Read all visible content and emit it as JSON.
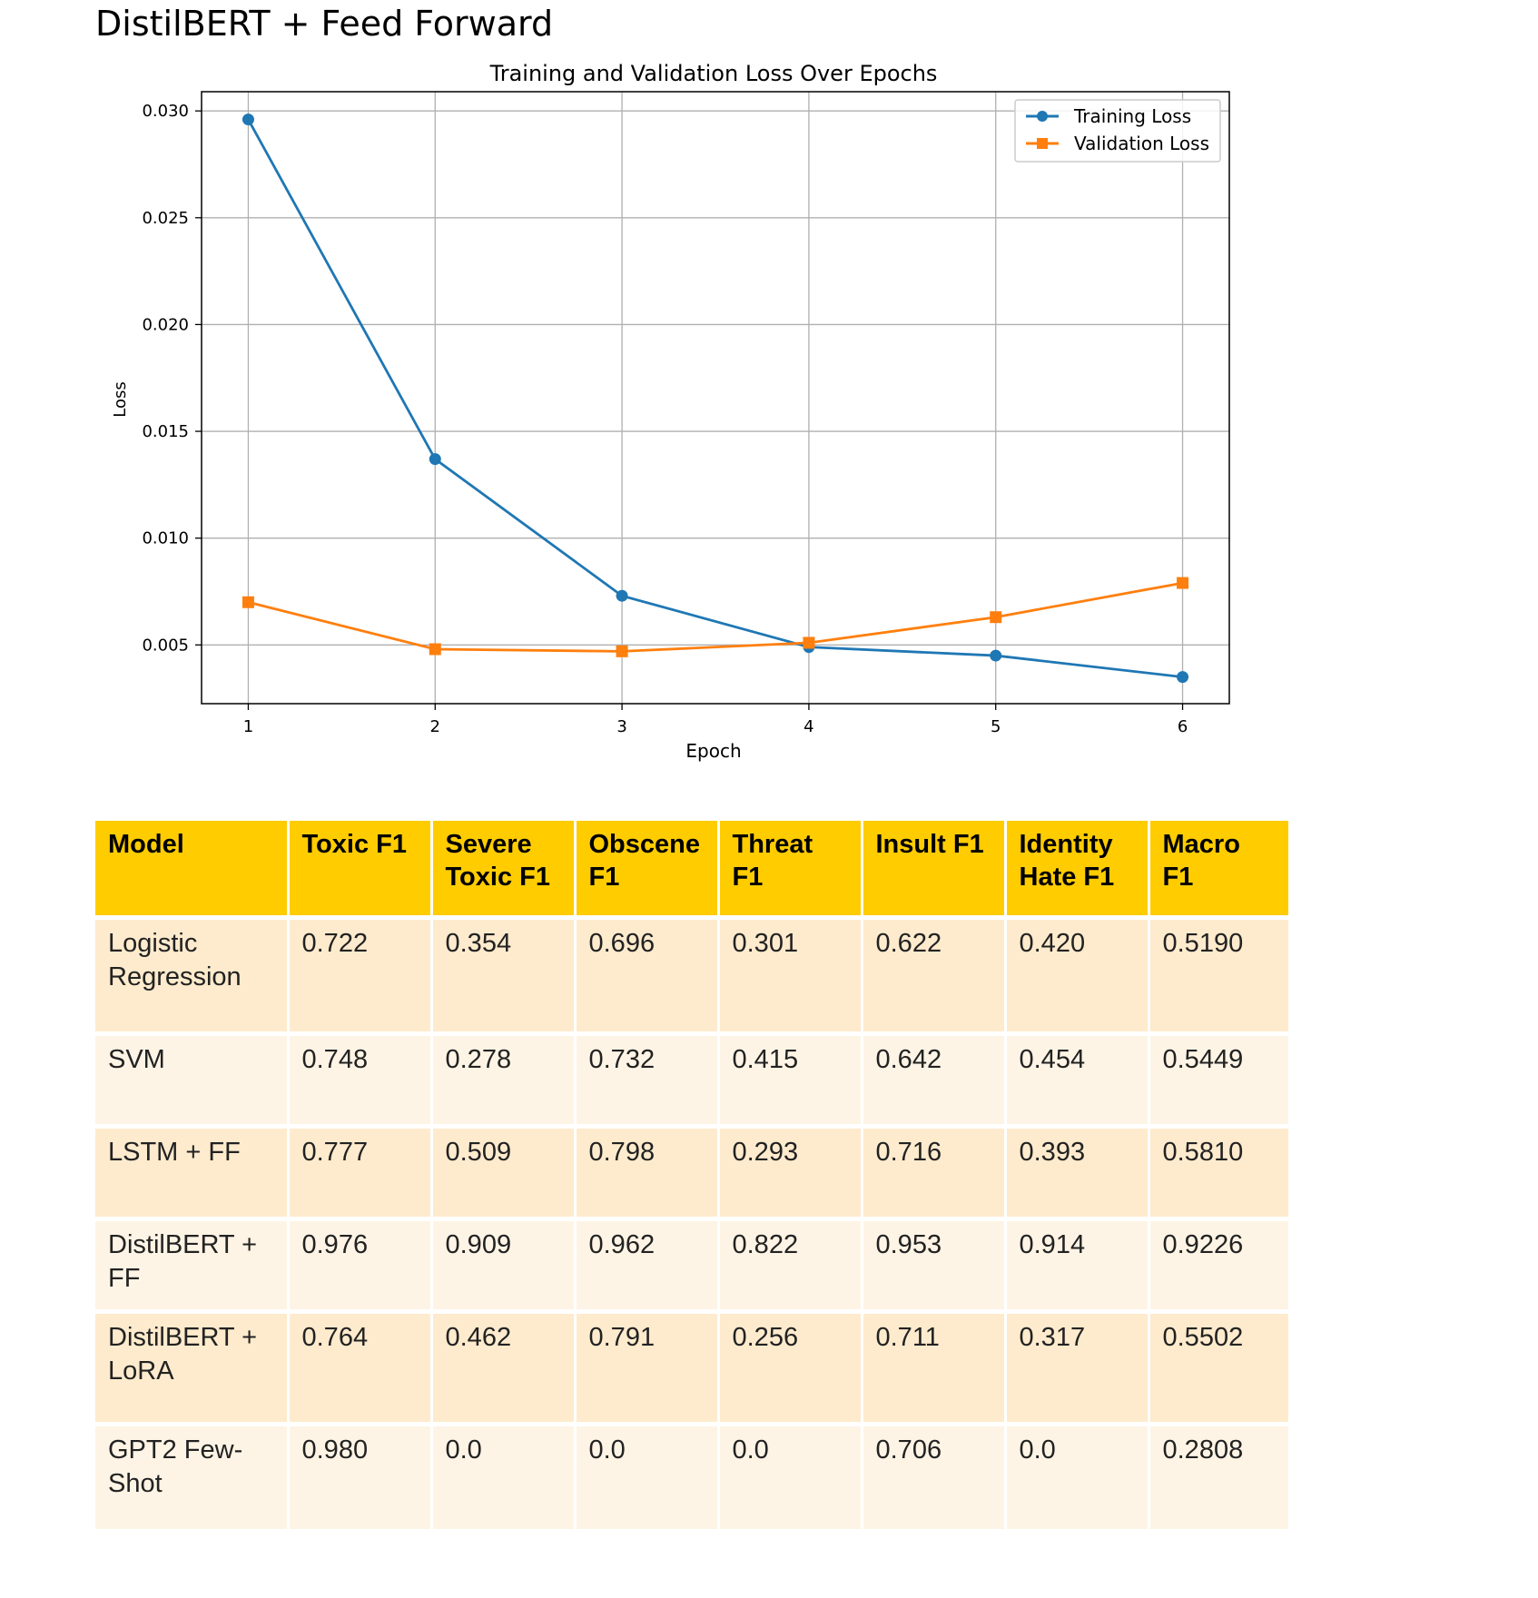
{
  "page_title": "DistilBERT + Feed Forward",
  "chart_data": {
    "type": "line",
    "title": "Training and Validation Loss Over Epochs",
    "xlabel": "Epoch",
    "ylabel": "Loss",
    "x": [
      1,
      2,
      3,
      4,
      5,
      6
    ],
    "x_ticks": [
      "1",
      "2",
      "3",
      "4",
      "5",
      "6"
    ],
    "y_ticks": [
      "0.005",
      "0.010",
      "0.015",
      "0.020",
      "0.025",
      "0.030"
    ],
    "ylim": [
      0.00225,
      0.0309
    ],
    "xlim": [
      0.75,
      6.25
    ],
    "grid": true,
    "legend_position": "top-right",
    "series": [
      {
        "name": "Training Loss",
        "marker": "circle",
        "color": "#1f77b4",
        "values": [
          0.0296,
          0.0137,
          0.0073,
          0.0049,
          0.0045,
          0.0035
        ]
      },
      {
        "name": "Validation Loss",
        "marker": "square",
        "color": "#ff7f0e",
        "values": [
          0.007,
          0.0048,
          0.0047,
          0.0051,
          0.0063,
          0.0079
        ]
      }
    ]
  },
  "table": {
    "header_color": "#ffcc00",
    "headers": [
      "Model",
      "Toxic F1",
      "Severe Toxic F1",
      "Obscene F1",
      "Threat F1",
      "Insult F1",
      "Identity Hate F1",
      "Macro F1"
    ],
    "rows": [
      [
        "Logistic Regression",
        "0.722",
        "0.354",
        "0.696",
        "0.301",
        "0.622",
        "0.420",
        "0.5190"
      ],
      [
        "SVM",
        "0.748",
        "0.278",
        "0.732",
        "0.415",
        "0.642",
        "0.454",
        "0.5449"
      ],
      [
        "LSTM + FF",
        "0.777",
        "0.509",
        "0.798",
        "0.293",
        "0.716",
        "0.393",
        "0.5810"
      ],
      [
        "DistilBERT + FF",
        "0.976",
        "0.909",
        "0.962",
        "0.822",
        "0.953",
        "0.914",
        "0.9226"
      ],
      [
        "DistilBERT + LoRA",
        "0.764",
        "0.462",
        "0.791",
        "0.256",
        "0.711",
        "0.317",
        "0.5502"
      ],
      [
        "GPT2 Few-Shot",
        "0.980",
        "0.0",
        "0.0",
        "0.0",
        "0.706",
        "0.0",
        "0.2808"
      ]
    ]
  }
}
